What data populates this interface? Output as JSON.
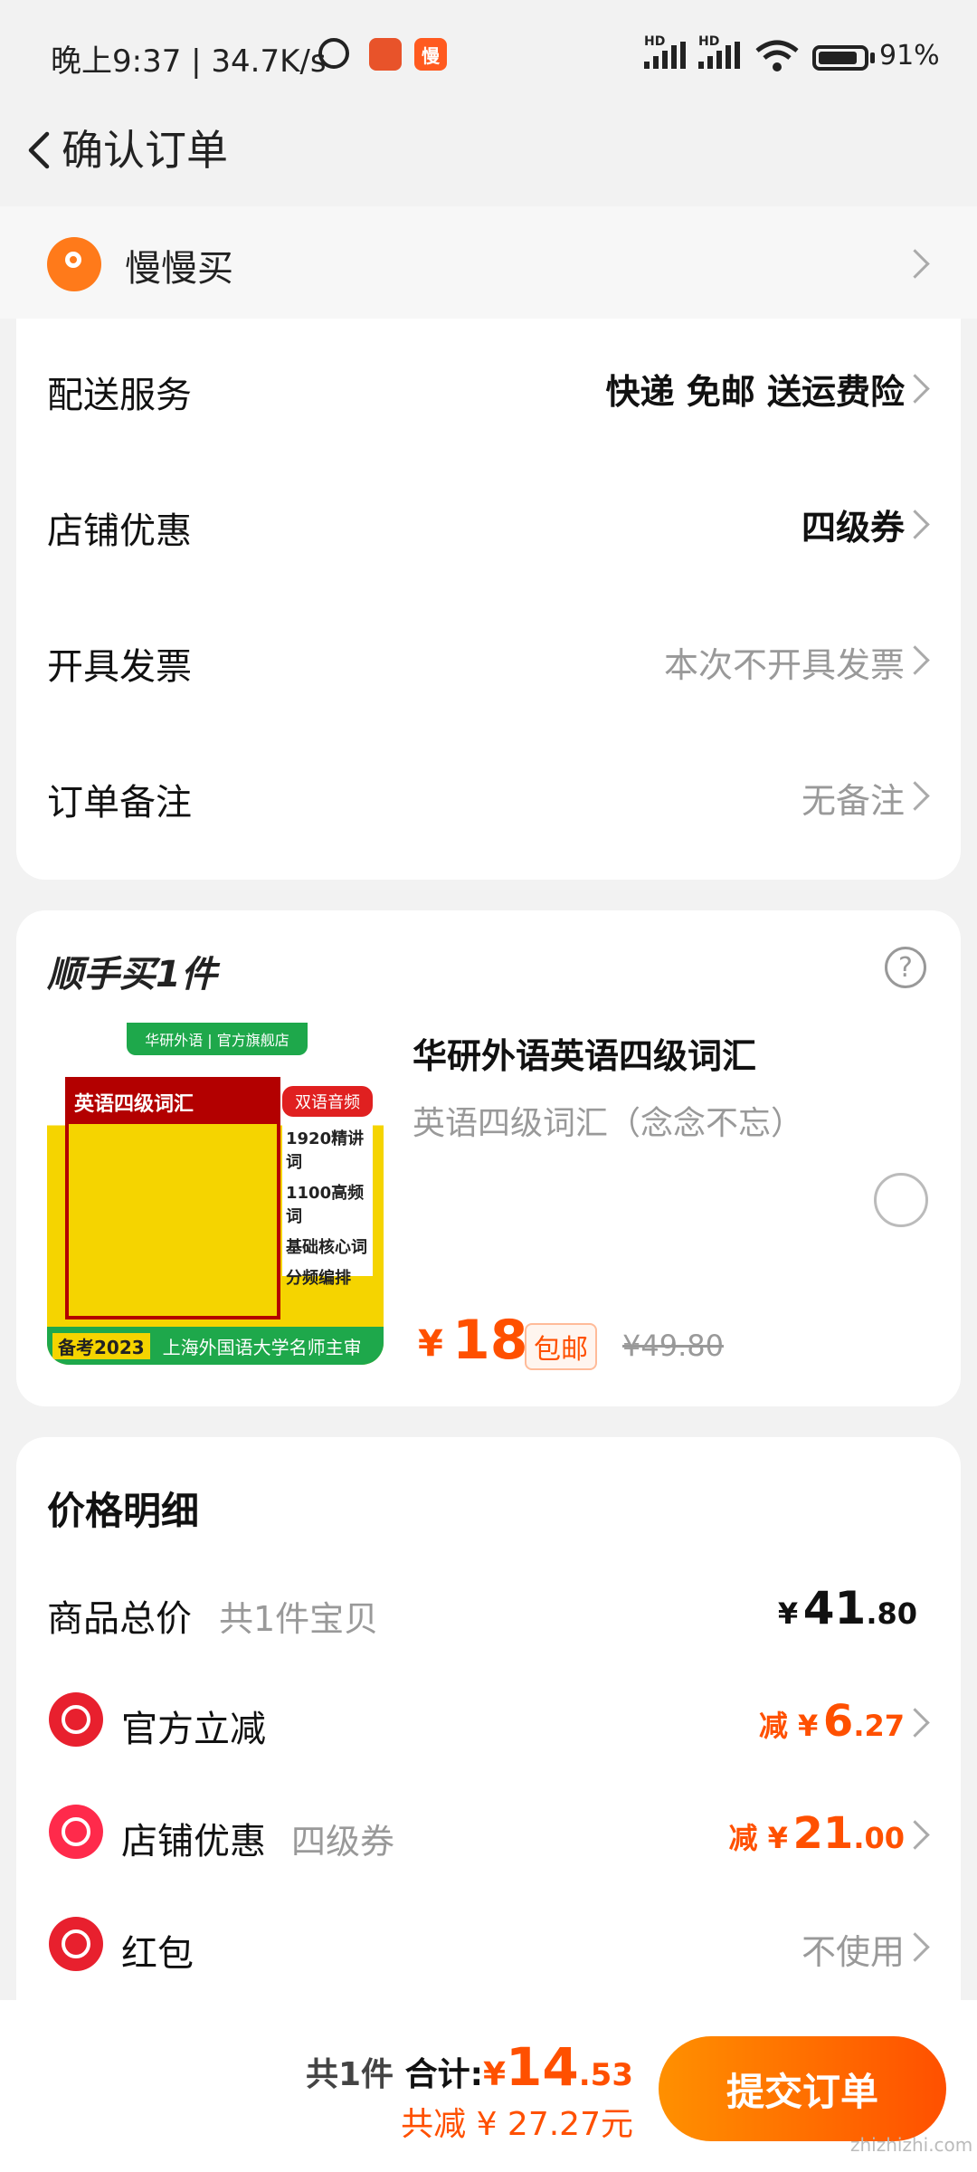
{
  "status_bar": {
    "time": "晚上9:37 | 34.7K/s",
    "app_badge_2": "慢",
    "hd1": "HD",
    "hd2": "HD",
    "battery": "91%"
  },
  "header": {
    "title": "确认订单"
  },
  "address": {
    "name": "慢慢买"
  },
  "order_options": {
    "delivery_label": "配送服务",
    "delivery_value": "快递 免邮 送运费险",
    "shop_discount_label": "店铺优惠",
    "shop_discount_value": "四级券",
    "invoice_label": "开具发票",
    "invoice_value": "本次不开具发票",
    "note_label": "订单备注",
    "note_value": "无备注"
  },
  "addon": {
    "title": "顺手买1件",
    "help": "?",
    "product": {
      "name": "华研外语英语四级词汇",
      "variant": "英语四级词汇（念念不忘）",
      "currency": "¥",
      "price": "18",
      "free_shipping": "包邮",
      "original_price": "¥49.80",
      "image": {
        "banner": "华研外语 | 官方旗舰店",
        "cover_title": "英语四级词汇",
        "tag": "双语音频",
        "lines": [
          "1920精讲词",
          "1100高频词",
          "基础核心词",
          "分频编排"
        ],
        "footer_year": "备考2023",
        "footer_text": "上海外国语大学名师主审"
      }
    }
  },
  "price_detail": {
    "title": "价格明细",
    "goods_total_label": "商品总价",
    "goods_total_sub": "共1件宝贝",
    "goods_total_cur": "¥",
    "goods_total_int": "41",
    "goods_total_dec": ".80",
    "official_label": "官方立减",
    "official_value_prefix": "减 ¥",
    "official_value_int": "6",
    "official_value_dec": ".27",
    "shop_label": "店铺优惠",
    "shop_sub": "四级券",
    "shop_value_prefix": "减 ¥",
    "shop_value_int": "21",
    "shop_value_dec": ".00",
    "redpacket_label": "红包",
    "redpacket_value": "不使用"
  },
  "bottom_bar": {
    "count": "共1件",
    "total_label": "合计:",
    "total_cur": "¥",
    "total_int": "14",
    "total_dec": ".53",
    "saved": "共减 ¥ 27.27元",
    "submit": "提交订单",
    "watermark": "zhizhizhi.com"
  },
  "colors": {
    "accent": "#ff5000",
    "accent_light": "#ff9000"
  }
}
